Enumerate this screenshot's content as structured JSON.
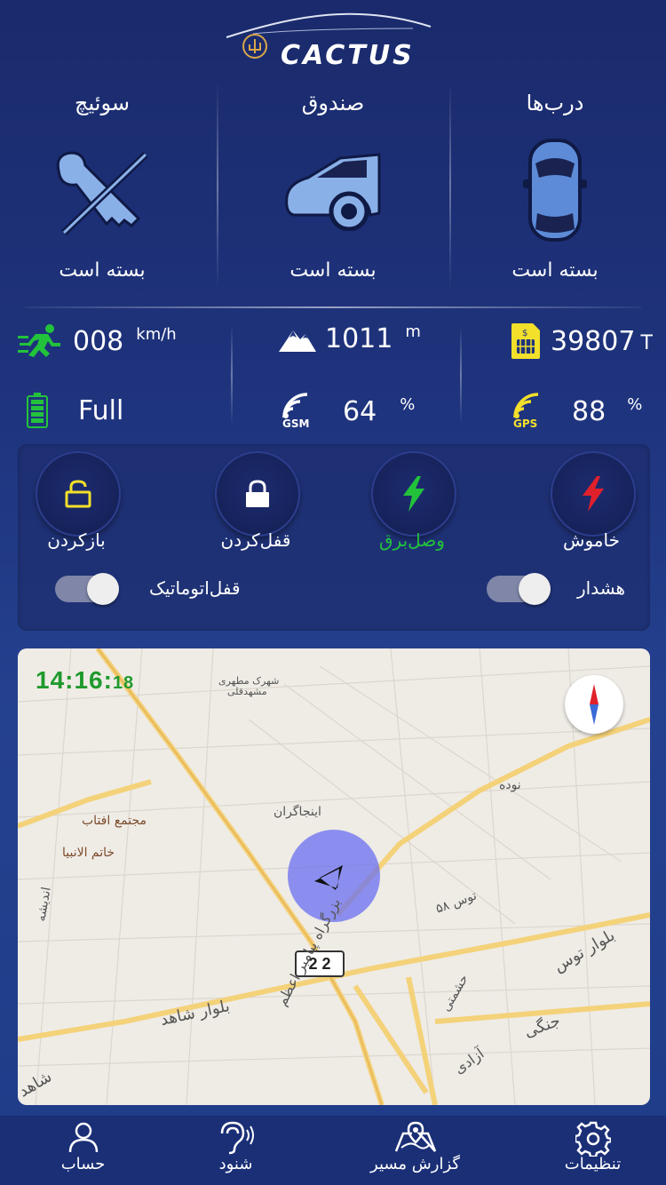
{
  "brand": {
    "name": "CACTUS"
  },
  "status": [
    {
      "title": "درب‌ها",
      "state": "بسته است",
      "icon": "car-top-icon"
    },
    {
      "title": "صندوق",
      "state": "بسته است",
      "icon": "car-trunk-icon"
    },
    {
      "title": "سوئیچ",
      "state": "بسته است",
      "icon": "key-crossed-icon"
    }
  ],
  "metrics": {
    "speed": {
      "value": "008",
      "unit": "km/h"
    },
    "altitude": {
      "value": "1011",
      "unit": "m"
    },
    "credit": {
      "value": "39807",
      "unit": "T"
    },
    "battery": {
      "value": "Full"
    },
    "gsm": {
      "value": "64",
      "unit": "%",
      "label": "GSM"
    },
    "gps": {
      "value": "88",
      "unit": "%",
      "label": "GPS"
    }
  },
  "controls": {
    "unlock": "بازکردن",
    "lock": "قفل‌کردن",
    "power_on": "وصل‌برق",
    "power_off": "خاموش",
    "auto_lock": "قفل‌اتوماتیک",
    "alarm": "هشدار"
  },
  "map": {
    "time_main": "14:16:",
    "time_sec": "18",
    "route_number": "2 2",
    "labels": [
      "بزرگراه پیامبر اعظم",
      "بلوار شاهد",
      "بلوار توس",
      "اینجاگران",
      "خاتم الانبیا",
      "مجتمع افتاب",
      "توس ۵۸",
      "آزادی",
      "جنگی",
      "حشمتی",
      "شهرک مطهری",
      "مشهدقلی",
      "اندیشه",
      "نوده",
      "شاهد"
    ]
  },
  "tabs": [
    {
      "label": "حساب",
      "icon": "user-icon"
    },
    {
      "label": "شنود",
      "icon": "ear-listen-icon"
    },
    {
      "label": "گزارش مسیر",
      "icon": "route-map-icon"
    },
    {
      "label": "تنظیمات",
      "icon": "gear-icon"
    }
  ],
  "colors": {
    "accent_green": "#22c33b",
    "warning_yellow": "#f2e02b",
    "danger_red": "#e0202b",
    "background": "#1f347e"
  }
}
